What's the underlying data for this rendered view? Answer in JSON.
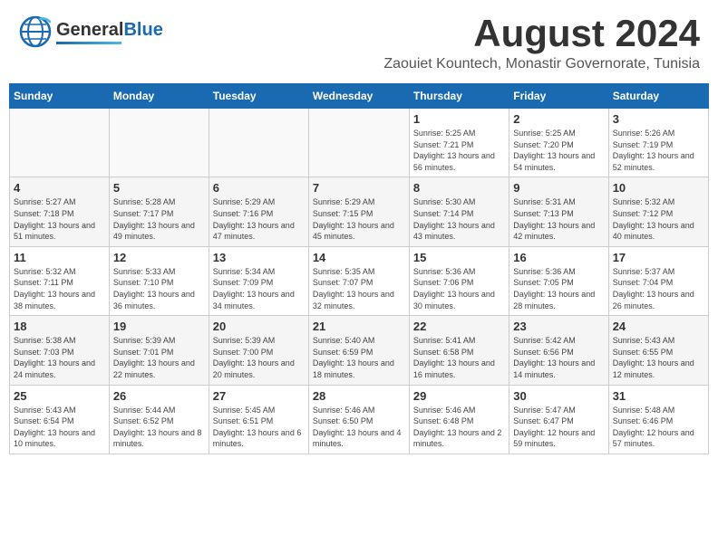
{
  "logo": {
    "general": "General",
    "blue": "Blue"
  },
  "title": {
    "month_year": "August 2024",
    "location": "Zaouiet Kountech, Monastir Governorate, Tunisia"
  },
  "headers": [
    "Sunday",
    "Monday",
    "Tuesday",
    "Wednesday",
    "Thursday",
    "Friday",
    "Saturday"
  ],
  "weeks": [
    {
      "days": [
        {
          "num": "",
          "info": ""
        },
        {
          "num": "",
          "info": ""
        },
        {
          "num": "",
          "info": ""
        },
        {
          "num": "",
          "info": ""
        },
        {
          "num": "1",
          "info": "Sunrise: 5:25 AM\nSunset: 7:21 PM\nDaylight: 13 hours and 56 minutes."
        },
        {
          "num": "2",
          "info": "Sunrise: 5:25 AM\nSunset: 7:20 PM\nDaylight: 13 hours and 54 minutes."
        },
        {
          "num": "3",
          "info": "Sunrise: 5:26 AM\nSunset: 7:19 PM\nDaylight: 13 hours and 52 minutes."
        }
      ]
    },
    {
      "days": [
        {
          "num": "4",
          "info": "Sunrise: 5:27 AM\nSunset: 7:18 PM\nDaylight: 13 hours and 51 minutes."
        },
        {
          "num": "5",
          "info": "Sunrise: 5:28 AM\nSunset: 7:17 PM\nDaylight: 13 hours and 49 minutes."
        },
        {
          "num": "6",
          "info": "Sunrise: 5:29 AM\nSunset: 7:16 PM\nDaylight: 13 hours and 47 minutes."
        },
        {
          "num": "7",
          "info": "Sunrise: 5:29 AM\nSunset: 7:15 PM\nDaylight: 13 hours and 45 minutes."
        },
        {
          "num": "8",
          "info": "Sunrise: 5:30 AM\nSunset: 7:14 PM\nDaylight: 13 hours and 43 minutes."
        },
        {
          "num": "9",
          "info": "Sunrise: 5:31 AM\nSunset: 7:13 PM\nDaylight: 13 hours and 42 minutes."
        },
        {
          "num": "10",
          "info": "Sunrise: 5:32 AM\nSunset: 7:12 PM\nDaylight: 13 hours and 40 minutes."
        }
      ]
    },
    {
      "days": [
        {
          "num": "11",
          "info": "Sunrise: 5:32 AM\nSunset: 7:11 PM\nDaylight: 13 hours and 38 minutes."
        },
        {
          "num": "12",
          "info": "Sunrise: 5:33 AM\nSunset: 7:10 PM\nDaylight: 13 hours and 36 minutes."
        },
        {
          "num": "13",
          "info": "Sunrise: 5:34 AM\nSunset: 7:09 PM\nDaylight: 13 hours and 34 minutes."
        },
        {
          "num": "14",
          "info": "Sunrise: 5:35 AM\nSunset: 7:07 PM\nDaylight: 13 hours and 32 minutes."
        },
        {
          "num": "15",
          "info": "Sunrise: 5:36 AM\nSunset: 7:06 PM\nDaylight: 13 hours and 30 minutes."
        },
        {
          "num": "16",
          "info": "Sunrise: 5:36 AM\nSunset: 7:05 PM\nDaylight: 13 hours and 28 minutes."
        },
        {
          "num": "17",
          "info": "Sunrise: 5:37 AM\nSunset: 7:04 PM\nDaylight: 13 hours and 26 minutes."
        }
      ]
    },
    {
      "days": [
        {
          "num": "18",
          "info": "Sunrise: 5:38 AM\nSunset: 7:03 PM\nDaylight: 13 hours and 24 minutes."
        },
        {
          "num": "19",
          "info": "Sunrise: 5:39 AM\nSunset: 7:01 PM\nDaylight: 13 hours and 22 minutes."
        },
        {
          "num": "20",
          "info": "Sunrise: 5:39 AM\nSunset: 7:00 PM\nDaylight: 13 hours and 20 minutes."
        },
        {
          "num": "21",
          "info": "Sunrise: 5:40 AM\nSunset: 6:59 PM\nDaylight: 13 hours and 18 minutes."
        },
        {
          "num": "22",
          "info": "Sunrise: 5:41 AM\nSunset: 6:58 PM\nDaylight: 13 hours and 16 minutes."
        },
        {
          "num": "23",
          "info": "Sunrise: 5:42 AM\nSunset: 6:56 PM\nDaylight: 13 hours and 14 minutes."
        },
        {
          "num": "24",
          "info": "Sunrise: 5:43 AM\nSunset: 6:55 PM\nDaylight: 13 hours and 12 minutes."
        }
      ]
    },
    {
      "days": [
        {
          "num": "25",
          "info": "Sunrise: 5:43 AM\nSunset: 6:54 PM\nDaylight: 13 hours and 10 minutes."
        },
        {
          "num": "26",
          "info": "Sunrise: 5:44 AM\nSunset: 6:52 PM\nDaylight: 13 hours and 8 minutes."
        },
        {
          "num": "27",
          "info": "Sunrise: 5:45 AM\nSunset: 6:51 PM\nDaylight: 13 hours and 6 minutes."
        },
        {
          "num": "28",
          "info": "Sunrise: 5:46 AM\nSunset: 6:50 PM\nDaylight: 13 hours and 4 minutes."
        },
        {
          "num": "29",
          "info": "Sunrise: 5:46 AM\nSunset: 6:48 PM\nDaylight: 13 hours and 2 minutes."
        },
        {
          "num": "30",
          "info": "Sunrise: 5:47 AM\nSunset: 6:47 PM\nDaylight: 12 hours and 59 minutes."
        },
        {
          "num": "31",
          "info": "Sunrise: 5:48 AM\nSunset: 6:46 PM\nDaylight: 12 hours and 57 minutes."
        }
      ]
    }
  ]
}
